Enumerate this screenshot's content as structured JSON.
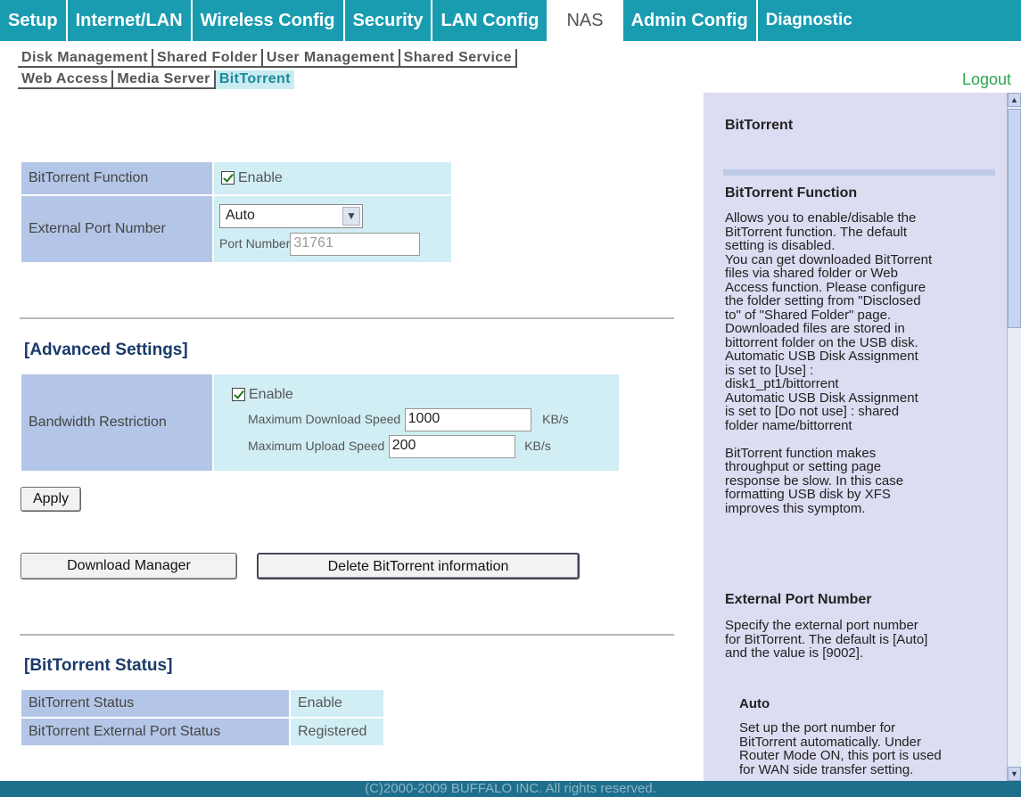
{
  "nav": {
    "tabs": [
      {
        "label": "Setup"
      },
      {
        "label": "Internet/LAN"
      },
      {
        "label": "Wireless Config"
      },
      {
        "label": "Security"
      },
      {
        "label": "LAN Config"
      },
      {
        "label": "NAS",
        "active": true
      },
      {
        "label": "Admin Config"
      },
      {
        "label": "Diagnostic"
      }
    ]
  },
  "subnav": {
    "row1": [
      {
        "label": "Disk Management"
      },
      {
        "label": "Shared Folder"
      },
      {
        "label": "User Management"
      },
      {
        "label": "Shared Service"
      }
    ],
    "row2": [
      {
        "label": "Web Access"
      },
      {
        "label": "Media Server"
      },
      {
        "label": "BitTorrent",
        "active": true
      }
    ],
    "logout": "Logout"
  },
  "bittorrent": {
    "function_label": "BitTorrent Function",
    "enable_label": "Enable",
    "enabled": true,
    "port_label": "External Port Number",
    "port_mode": "Auto",
    "port_number_label": "Port Number",
    "port_number_value": "31761"
  },
  "advanced": {
    "title": "[Advanced Settings]",
    "bandwidth_label": "Bandwidth Restriction",
    "enable_label": "Enable",
    "enabled": true,
    "max_download_label": "Maximum Download Speed",
    "max_download_value": "1000",
    "max_upload_label": "Maximum Upload Speed",
    "max_upload_value": "200",
    "unit": "KB/s"
  },
  "buttons": {
    "apply": "Apply",
    "download_manager": "Download Manager",
    "delete_info": "Delete BitTorrent information"
  },
  "status": {
    "title": "[BitTorrent Status]",
    "rows": [
      {
        "label": "BitTorrent Status",
        "value": "Enable"
      },
      {
        "label": "BitTorrent External Port Status",
        "value": "Registered"
      }
    ]
  },
  "help": {
    "title": "BitTorrent",
    "sections": [
      {
        "heading": "BitTorrent Function",
        "body": "Allows you to enable/disable the\nBitTorrent function. The default\nsetting is disabled.\nYou can get downloaded BitTorrent\nfiles via shared folder or Web\nAccess function. Please configure\nthe folder setting from \"Disclosed\nto\" of \"Shared Folder\" page.\nDownloaded files are stored in\nbittorrent folder on the USB disk.\nAutomatic USB Disk Assignment\nis set to [Use] :\ndisk1_pt1/bittorrent\nAutomatic USB Disk Assignment\nis set to [Do not use] : shared\nfolder name/bittorrent\n\nBitTorrent function makes\nthroughput or setting page\nresponse be slow. In this case\nformatting USB disk by XFS\nimproves this symptom."
      },
      {
        "heading": "External Port Number",
        "body": "Specify the external port number\nfor BitTorrent. The default is [Auto]\nand the value is [9002]."
      },
      {
        "heading": "Auto",
        "body": "Set up the port number for\nBitTorrent automatically. Under\nRouter Mode ON, this port is used\nfor WAN side transfer setting."
      }
    ]
  },
  "footer": "(C)2000-2009 BUFFALO INC. All rights reserved."
}
